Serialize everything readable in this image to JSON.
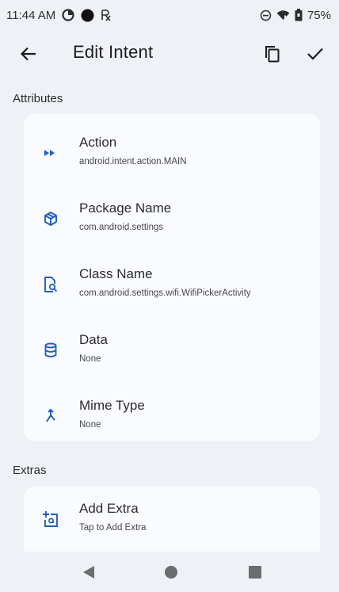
{
  "status_bar": {
    "time": "11:44 AM",
    "battery": "75%",
    "icons_left": [
      "data-saver-icon",
      "circle-app-icon",
      "prescription-icon"
    ],
    "icons_right": [
      "dnd-icon",
      "wifi-icon",
      "battery-icon"
    ]
  },
  "app_bar": {
    "title": "Edit Intent",
    "back_icon": "arrow-back-icon",
    "copy_icon": "copy-icon",
    "confirm_icon": "check-icon"
  },
  "attributes": {
    "section_label": "Attributes",
    "items": [
      {
        "title": "Action",
        "value": "android.intent.action.MAIN",
        "icon": "fast-forward-icon"
      },
      {
        "title": "Package Name",
        "value": "com.android.settings",
        "icon": "package-icon"
      },
      {
        "title": "Class Name",
        "value": "com.android.settings.wifi.WifiPickerActivity",
        "icon": "file-search-icon"
      },
      {
        "title": "Data",
        "value": "None",
        "icon": "database-icon"
      },
      {
        "title": "Mime Type",
        "value": "None",
        "icon": "merge-icon"
      }
    ]
  },
  "extras": {
    "section_label": "Extras",
    "items": [
      {
        "title": "Add Extra",
        "value": "Tap to Add Extra",
        "icon": "add-extra-icon"
      }
    ]
  },
  "nav_bar": {
    "buttons": [
      "back-triangle-icon",
      "home-circle-icon",
      "recents-square-icon"
    ]
  },
  "colors": {
    "background": "#eff1f6",
    "card": "#fafbff",
    "accent": "#1f5fbf",
    "text": "#1b1c20"
  }
}
